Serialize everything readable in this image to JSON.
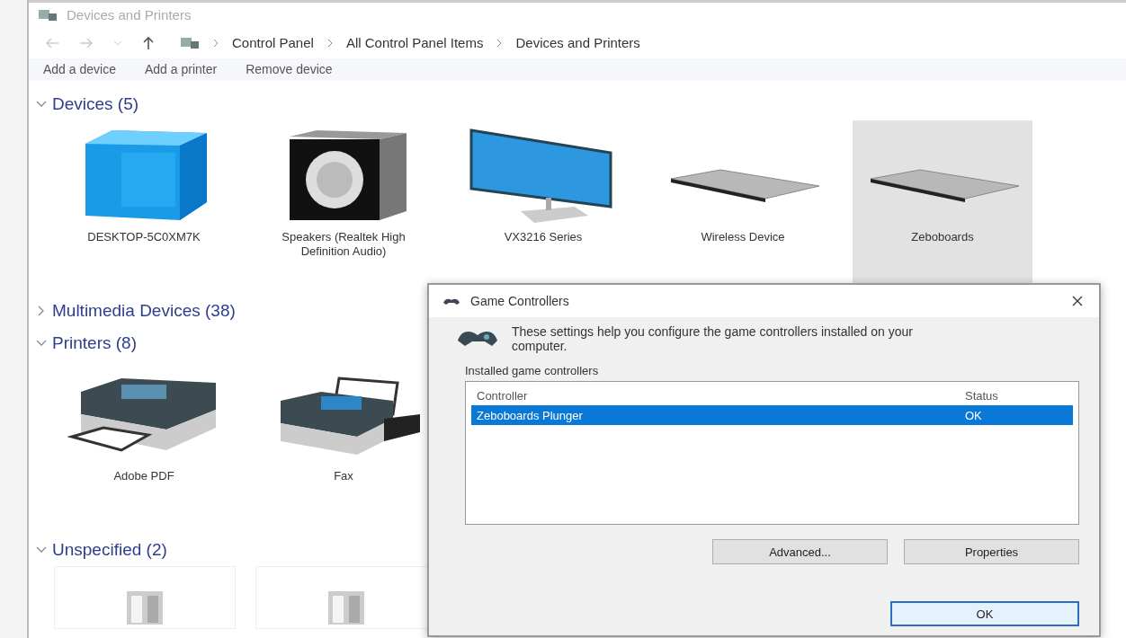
{
  "window": {
    "title": "Devices and Printers"
  },
  "address_bar": {
    "breadcrumb": [
      "Control Panel",
      "All Control Panel Items",
      "Devices and Printers"
    ]
  },
  "toolbar": [
    "Add a device",
    "Add a printer",
    "Remove device"
  ],
  "groups": [
    {
      "title": "Devices (5)",
      "expanded": true,
      "items": [
        {
          "kind": "computer",
          "label": "DESKTOP-5C0XM7K",
          "selected": false
        },
        {
          "kind": "speaker",
          "label": "Speakers (Realtek High Definition Audio)",
          "selected": false
        },
        {
          "kind": "monitor",
          "label": "VX3216 Series",
          "selected": false
        },
        {
          "kind": "keyboard",
          "label": "Wireless Device",
          "selected": false
        },
        {
          "kind": "keyboard",
          "label": "Zeboboards",
          "selected": true
        }
      ]
    },
    {
      "title": "Multimedia Devices (38)",
      "expanded": false
    },
    {
      "title": "Printers (8)",
      "expanded": true,
      "items": [
        {
          "kind": "printer",
          "label": "Adobe PDF",
          "selected": false
        },
        {
          "kind": "fax",
          "label": "Fax",
          "selected": false
        }
      ]
    },
    {
      "title": "Unspecified (2)",
      "expanded": true,
      "items": [
        {
          "kind": "unspecified",
          "selected": false
        },
        {
          "kind": "unspecified",
          "selected": false
        }
      ]
    }
  ],
  "dialog": {
    "title": "Game Controllers",
    "description": "These settings help you configure the game controllers installed on your computer.",
    "list_label": "Installed game controllers",
    "columns": [
      "Controller",
      "Status"
    ],
    "rows": [
      {
        "cells": [
          "Zeboboards Plunger",
          "OK"
        ],
        "selected": true
      }
    ],
    "buttons": [
      {
        "label": "Advanced...",
        "default": false
      },
      {
        "label": "Properties",
        "default": false
      }
    ],
    "footer_buttons": [
      {
        "label": "OK",
        "default": true
      }
    ]
  }
}
